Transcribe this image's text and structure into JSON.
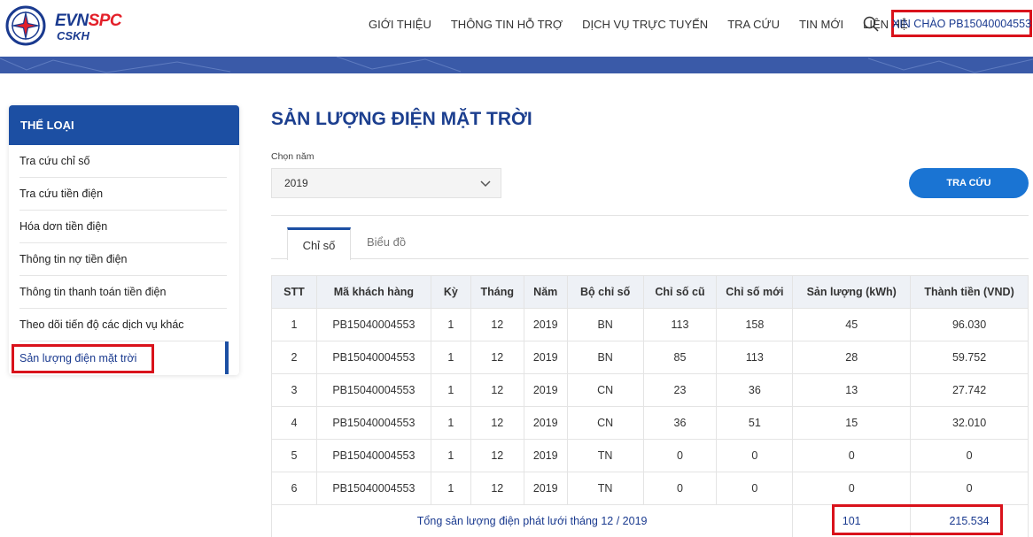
{
  "brand": {
    "line1_evn": "EVN",
    "line1_spc": "SPC",
    "line2": "CSKH"
  },
  "nav": [
    "GIỚI THIỆU",
    "THÔNG TIN HỖ TRỢ",
    "DỊCH VỤ TRỰC TUYẾN",
    "TRA CỨU",
    "TIN MỚI",
    "LIÊN HỆ"
  ],
  "greeting": "XIN CHÀO PB15040004553",
  "sidebar": {
    "title": "THỂ LOẠI",
    "items": [
      "Tra cứu chỉ số",
      "Tra cứu tiền điện",
      "Hóa dơn tiền điện",
      "Thông tin nợ tiền điện",
      "Thông tin thanh toán tiền điện",
      "Theo dõi tiến độ các dịch vụ khác",
      "Sản lượng điện mặt trời"
    ]
  },
  "main": {
    "title": "SẢN LƯỢNG ĐIỆN MẶT TRỜI",
    "year_label": "Chọn năm",
    "year_value": "2019",
    "search_button": "TRA CỨU",
    "tabs": [
      "Chỉ số",
      "Biểu đồ"
    ]
  },
  "table": {
    "headers": [
      "STT",
      "Mã khách hàng",
      "Kỳ",
      "Tháng",
      "Năm",
      "Bộ chỉ số",
      "Chỉ số cũ",
      "Chỉ số mới",
      "Sản lượng (kWh)",
      "Thành tiền (VND)"
    ],
    "rows": [
      [
        "1",
        "PB15040004553",
        "1",
        "12",
        "2019",
        "BN",
        "113",
        "158",
        "45",
        "96.030"
      ],
      [
        "2",
        "PB15040004553",
        "1",
        "12",
        "2019",
        "BN",
        "85",
        "113",
        "28",
        "59.752"
      ],
      [
        "3",
        "PB15040004553",
        "1",
        "12",
        "2019",
        "CN",
        "23",
        "36",
        "13",
        "27.742"
      ],
      [
        "4",
        "PB15040004553",
        "1",
        "12",
        "2019",
        "CN",
        "36",
        "51",
        "15",
        "32.010"
      ],
      [
        "5",
        "PB15040004553",
        "1",
        "12",
        "2019",
        "TN",
        "0",
        "0",
        "0",
        "0"
      ],
      [
        "6",
        "PB15040004553",
        "1",
        "12",
        "2019",
        "TN",
        "0",
        "0",
        "0",
        "0"
      ]
    ],
    "total_label": "Tổng sản lượng điện phát lưới tháng 12 / 2019",
    "total_kwh": "101",
    "total_vnd": "215.534"
  },
  "colors": {
    "brand_blue": "#1c4fa3",
    "brand_red": "#e3202a",
    "highlight_red": "#d9121b",
    "button_blue": "#1a74d3"
  }
}
